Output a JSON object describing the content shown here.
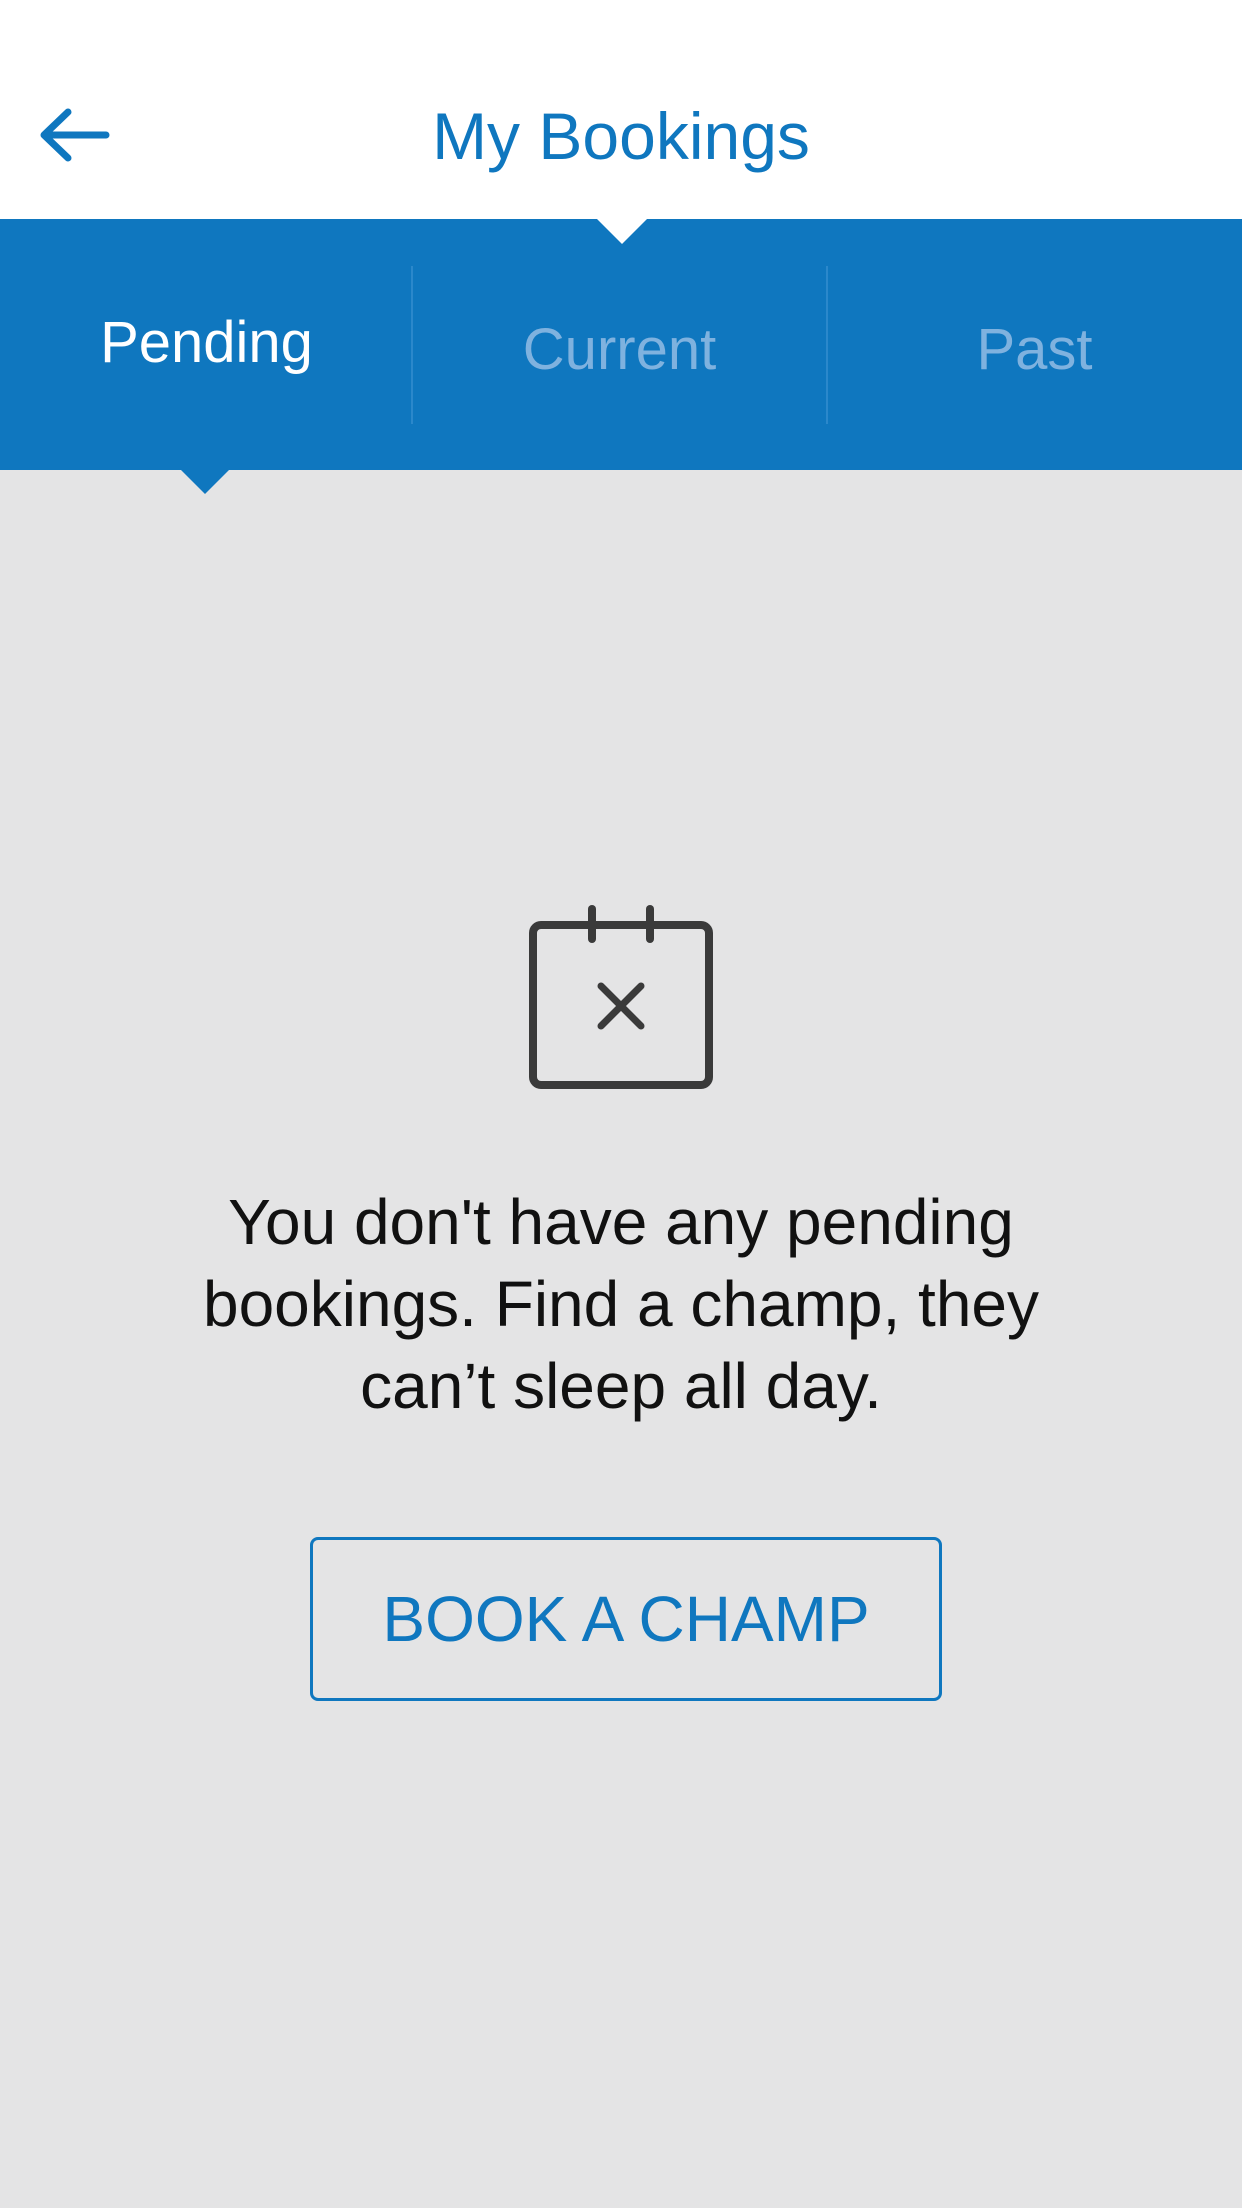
{
  "header": {
    "title": "My Bookings",
    "back_icon": "arrow-left-icon"
  },
  "tabs": [
    {
      "label": "Pending",
      "active": true
    },
    {
      "label": "Current",
      "active": false
    },
    {
      "label": "Past",
      "active": false
    }
  ],
  "empty_state": {
    "icon": "calendar-x-icon",
    "message": "You don't have any pending bookings. Find a champ, they can’t sleep all day.",
    "button_label": "BOOK A CHAMP"
  },
  "colors": {
    "accent": "#0f77bf",
    "background": "#e4e4e5",
    "header_background": "#ffffff",
    "tab_inactive_text": "#7fb2df",
    "icon": "#3a3a3a"
  }
}
